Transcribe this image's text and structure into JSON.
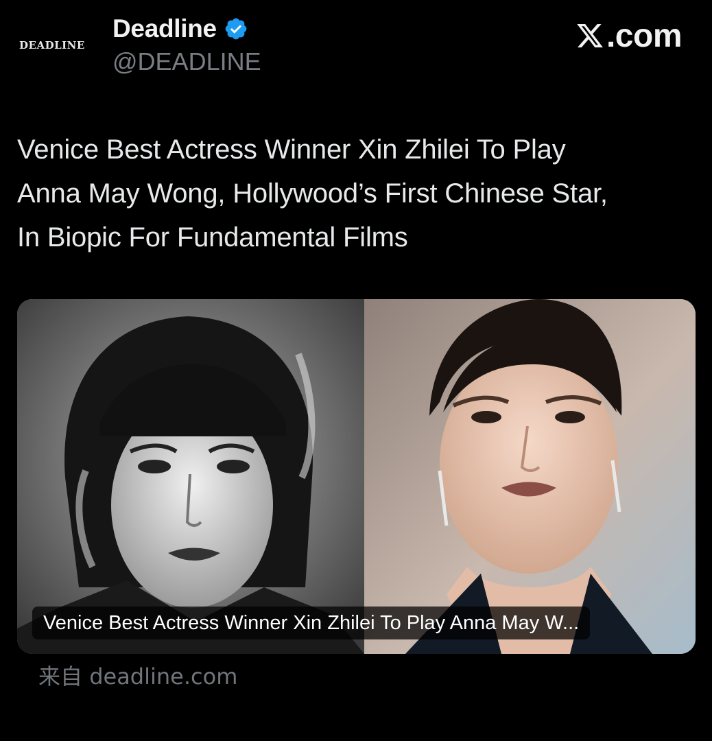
{
  "account": {
    "avatar_text": "DEADLINE",
    "display_name": "Deadline",
    "handle": "@DEADLINE",
    "verified_color": "#1d9bf0"
  },
  "site_logo": {
    "text": ".com"
  },
  "tweet": {
    "headline_lines": [
      "Venice Best Actress Winner Xin Zhilei To Play",
      "Anna May Wong, Hollywood’s First Chinese Star,",
      "In Biopic For Fundamental Films"
    ]
  },
  "card": {
    "caption": "Venice Best Actress Winner Xin Zhilei To Play Anna May W...",
    "source_prefix": "来自",
    "source_domain": "deadline.com"
  }
}
